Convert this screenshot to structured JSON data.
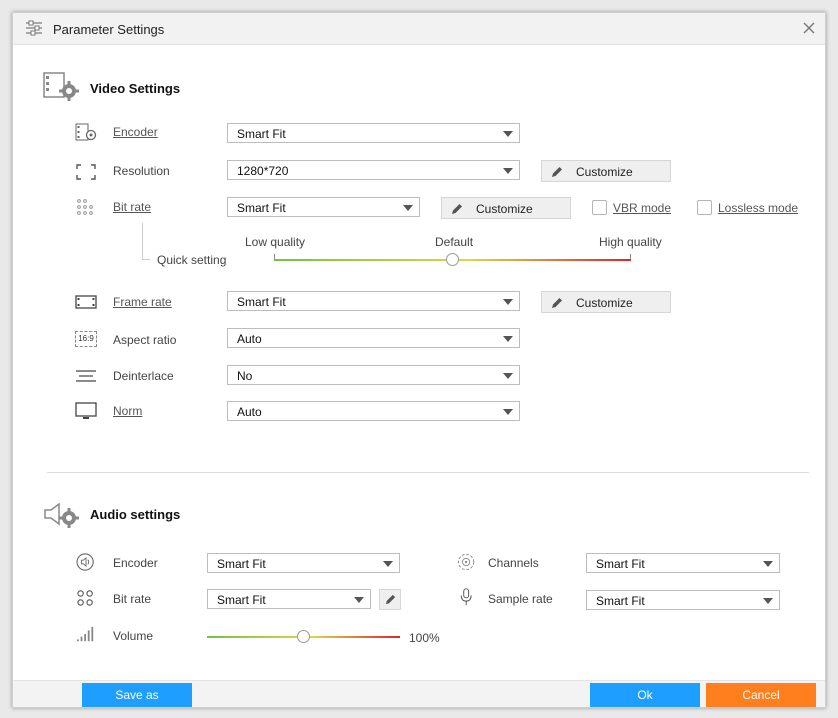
{
  "window": {
    "title": "Parameter Settings"
  },
  "video": {
    "section_title": "Video Settings",
    "encoder": {
      "label": "Encoder",
      "value": "Smart Fit"
    },
    "resolution": {
      "label": "Resolution",
      "value": "1280*720",
      "customize": "Customize"
    },
    "bitrate": {
      "label": "Bit rate",
      "value": "Smart Fit",
      "customize": "Customize",
      "vbr_label": "VBR mode",
      "lossless_label": "Lossless mode"
    },
    "quick_setting": {
      "label": "Quick setting",
      "low": "Low quality",
      "default": "Default",
      "high": "High quality",
      "level": 0.5
    },
    "framerate": {
      "label": "Frame rate",
      "value": "Smart Fit",
      "customize": "Customize"
    },
    "aspect": {
      "label": "Aspect ratio",
      "value": "Auto",
      "icon_text": "16:9"
    },
    "deinterlace": {
      "label": "Deinterlace",
      "value": "No"
    },
    "norm": {
      "label": "Norm",
      "value": "Auto"
    }
  },
  "audio": {
    "section_title": "Audio settings",
    "encoder": {
      "label": "Encoder",
      "value": "Smart Fit"
    },
    "bitrate": {
      "label": "Bit rate",
      "value": "Smart Fit"
    },
    "channels": {
      "label": "Channels",
      "value": "Smart Fit"
    },
    "samplerate": {
      "label": "Sample rate",
      "value": "Smart Fit"
    },
    "volume": {
      "label": "Volume",
      "value": "100%",
      "level": 0.5
    }
  },
  "footer": {
    "save_as": "Save as",
    "ok": "Ok",
    "cancel": "Cancel"
  },
  "colors": {
    "blue": "#1e9eff",
    "orange": "#ff7f1f",
    "green": "#77c043",
    "red": "#e0232e"
  }
}
